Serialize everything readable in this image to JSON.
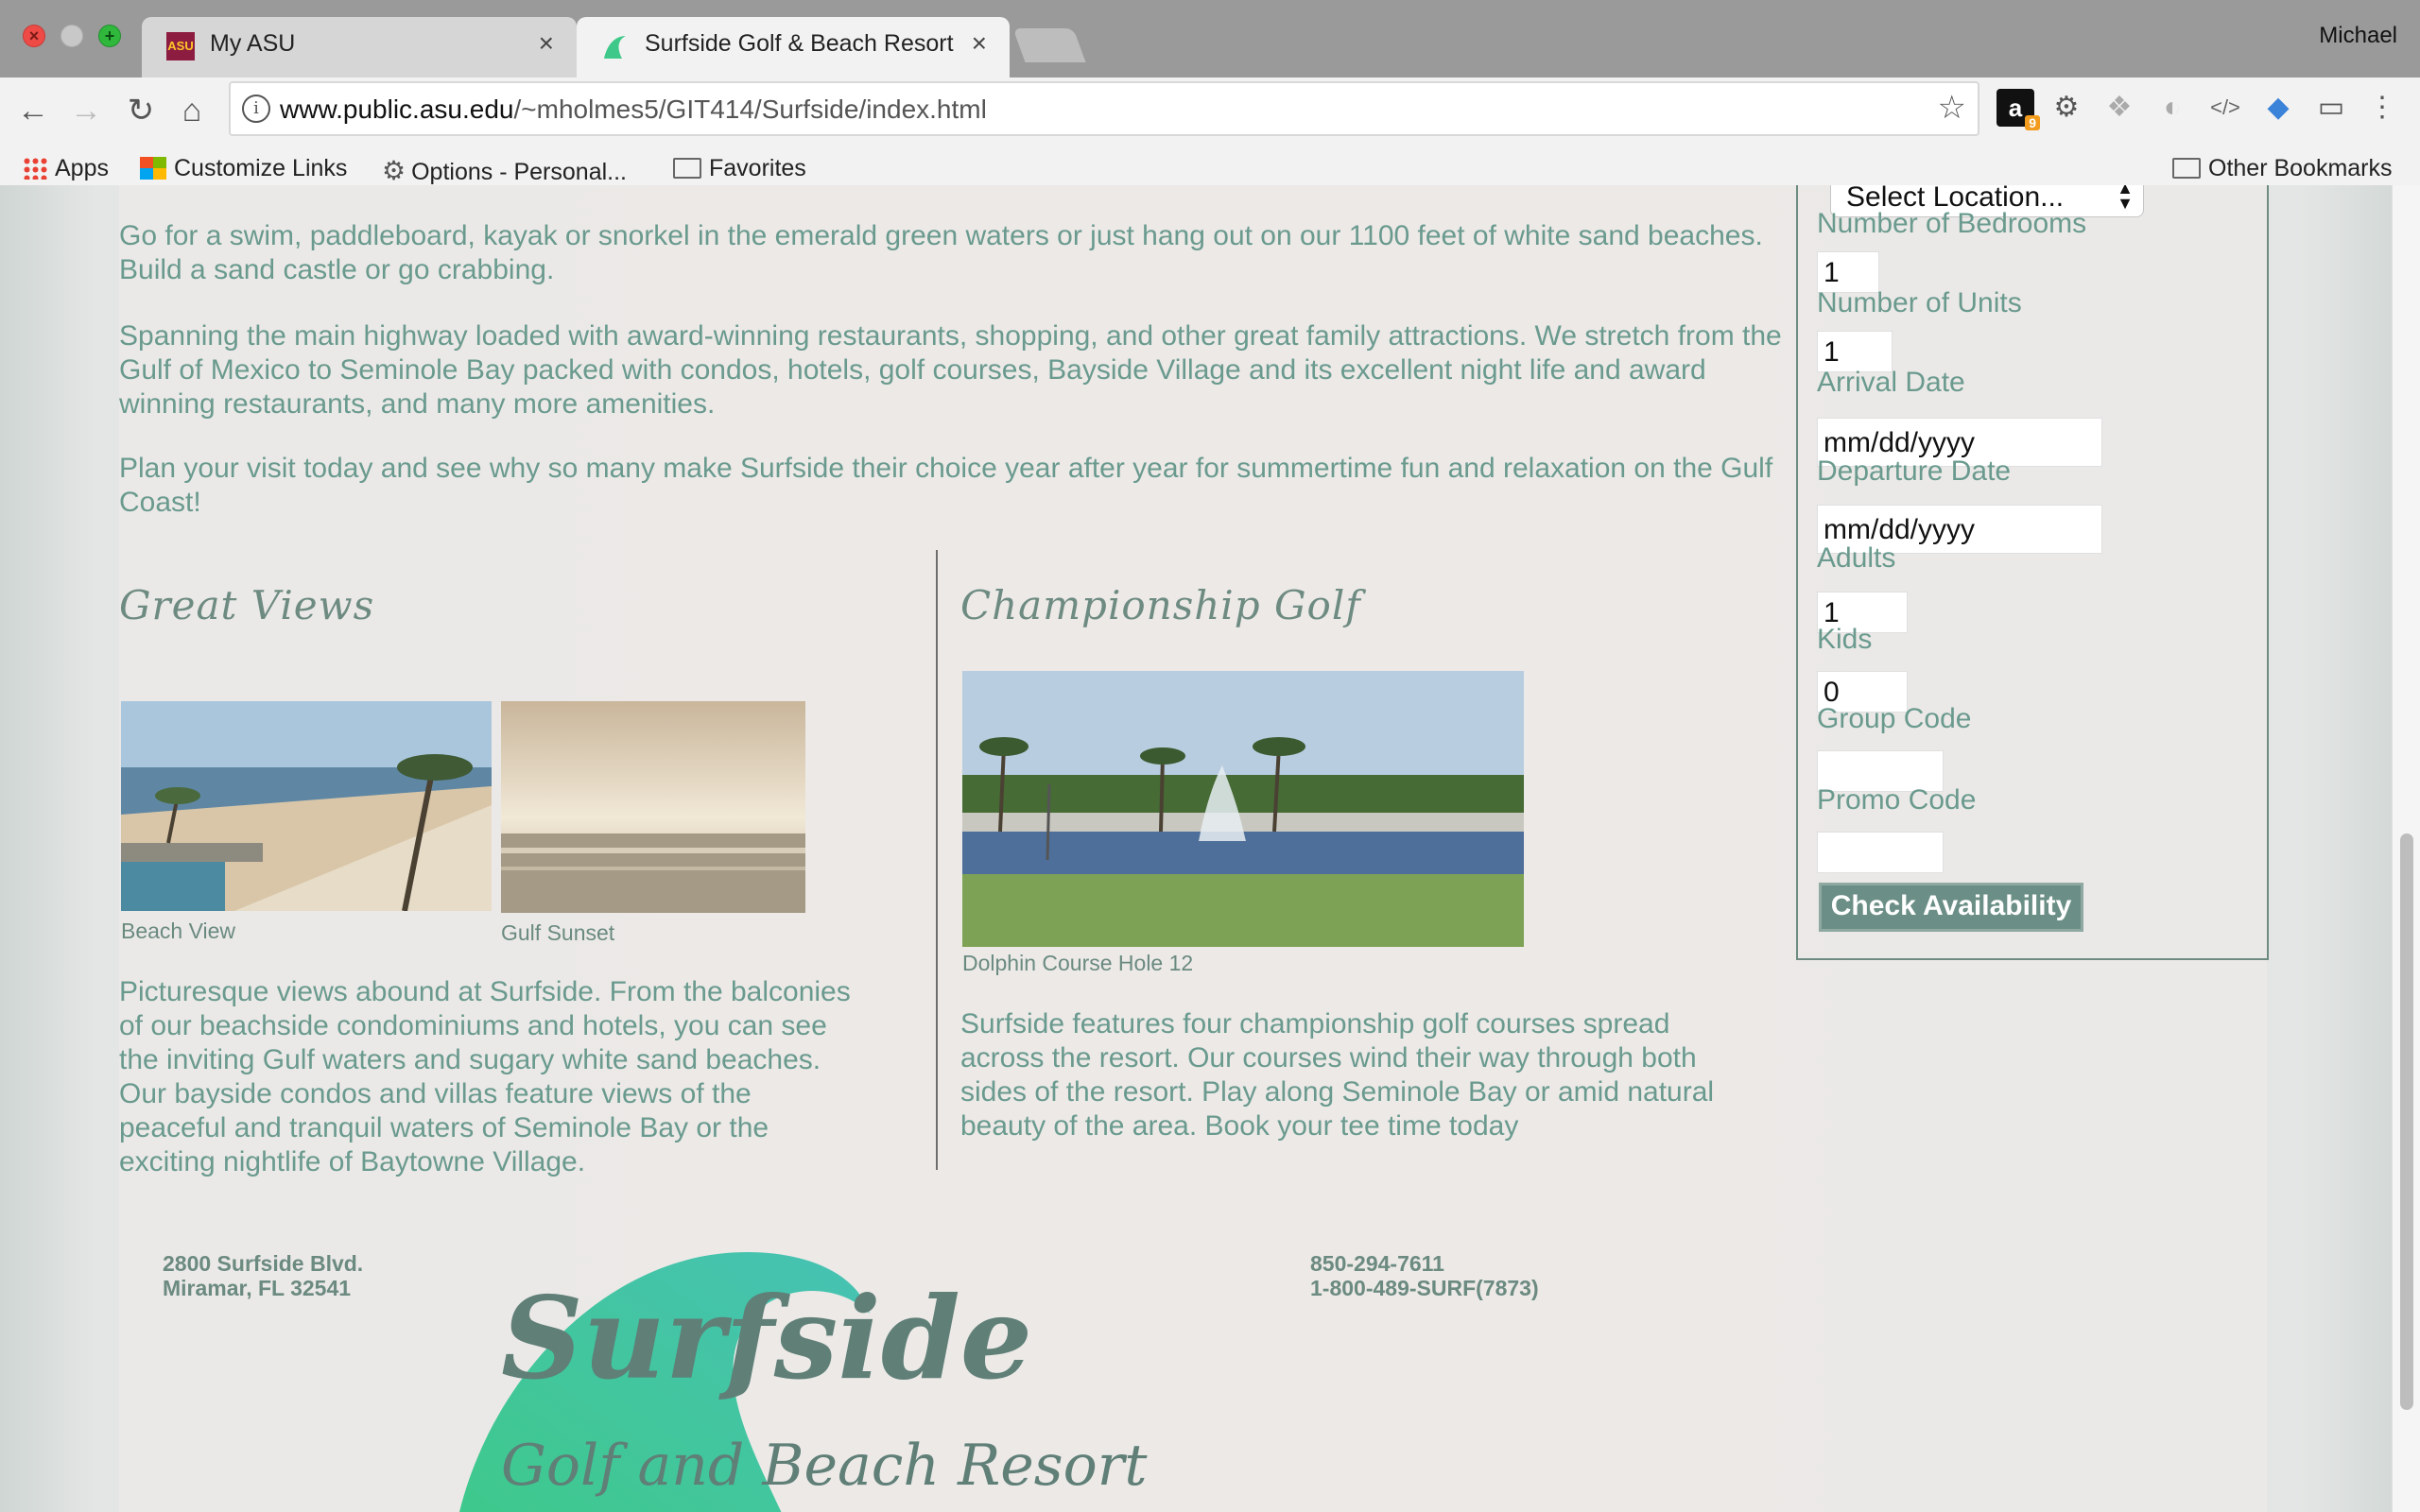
{
  "window": {
    "tabs": [
      {
        "title": "My ASU",
        "favicon": "asu-logo-icon"
      },
      {
        "title": "Surfside Golf & Beach Resort",
        "favicon": "surfside-wave-icon"
      }
    ],
    "profile_name": "Michael"
  },
  "toolbar": {
    "url_host": "www.public.asu.edu",
    "url_path": "/~mholmes5/GIT414/Surfside/index.html",
    "extension_badge": "9"
  },
  "bookmarks": {
    "items": [
      "Apps",
      "Customize Links",
      "Options - Personal...",
      "Favorites"
    ],
    "other": "Other Bookmarks"
  },
  "intro": {
    "p1": "Go for a swim, paddleboard, kayak or snorkel in the emerald green waters or just hang out on our 1100 feet of white sand beaches. Build a sand castle or go crabbing.",
    "p2": "Spanning the main highway loaded with award-winning restaurants, shopping, and other great family attractions. We stretch from the Gulf of Mexico to Seminole Bay packed with condos, hotels, golf courses, Bayside Village and its excellent night life and award winning restaurants, and many more amenities.",
    "p3": "Plan your visit today and see why so many make Surfside their choice year after year for summertime fun and relaxation on the Gulf Coast!"
  },
  "views": {
    "heading": "Great Views",
    "photo1_caption": "Beach View",
    "photo2_caption": "Gulf Sunset",
    "text": "Picturesque views abound at Surfside. From the balconies of our beachside condominiums and hotels, you can see the inviting Gulf waters and sugary white sand beaches. Our bayside condos and villas feature views of the peaceful and tranquil waters of Seminole Bay or the exciting nightlife of Baytowne Village."
  },
  "golf": {
    "heading": "Championship Golf",
    "photo_caption": "Dolphin Course Hole 12",
    "text": "Surfside features four championship golf courses spread across the resort. Our courses wind their way through both sides of the resort. Play along Seminole Bay or amid natural beauty of the area. Book your tee time today"
  },
  "booking": {
    "location_select": "Select Location...",
    "bedrooms_label": "Number of Bedrooms",
    "bedrooms_value": "1",
    "units_label": "Number of Units",
    "units_value": "1",
    "arrival_label": "Arrival Date",
    "arrival_placeholder": "mm/dd/yyyy",
    "departure_label": "Departure Date",
    "departure_placeholder": "mm/dd/yyyy",
    "adults_label": "Adults",
    "adults_value": "1",
    "kids_label": "Kids",
    "kids_value": "0",
    "group_label": "Group Code",
    "promo_label": "Promo Code",
    "submit": "Check Availability"
  },
  "footer": {
    "address_line1": "2800 Surfside Blvd.",
    "address_line2": "Miramar, FL 32541",
    "phone1": "850-294-7611",
    "phone2": "1-800-489-SURF(7873)",
    "logo_word": "Surfside",
    "logo_sub": "Golf and Beach Resort"
  },
  "colors": {
    "accent_text": "#6a9a8e",
    "button": "#6b8f86",
    "logo_green": "#3ec98a"
  }
}
